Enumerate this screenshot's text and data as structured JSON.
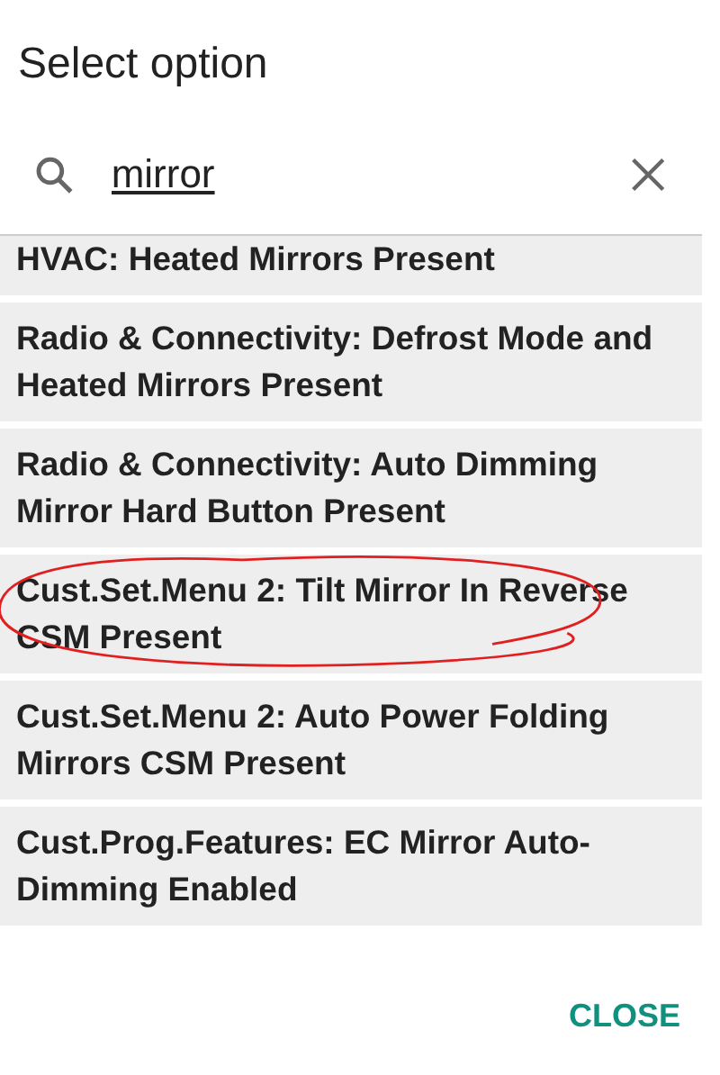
{
  "dialog": {
    "title": "Select option"
  },
  "search": {
    "value": "mirror"
  },
  "options": [
    {
      "label": "HVAC: Heated Mirrors Present",
      "circled": false
    },
    {
      "label": "Radio & Connectivity: Defrost Mode and Heated Mirrors Present",
      "circled": false
    },
    {
      "label": "Radio & Connectivity: Auto Dimming Mirror Hard Button Present",
      "circled": false
    },
    {
      "label": "Cust.Set.Menu 2: Tilt Mirror In Reverse CSM Present",
      "circled": true
    },
    {
      "label": "Cust.Set.Menu 2: Auto Power Folding Mirrors CSM Present",
      "circled": false
    },
    {
      "label": "Cust.Prog.Features: EC Mirror Auto-Dimming Enabled",
      "circled": false
    }
  ],
  "close_button": "CLOSE"
}
